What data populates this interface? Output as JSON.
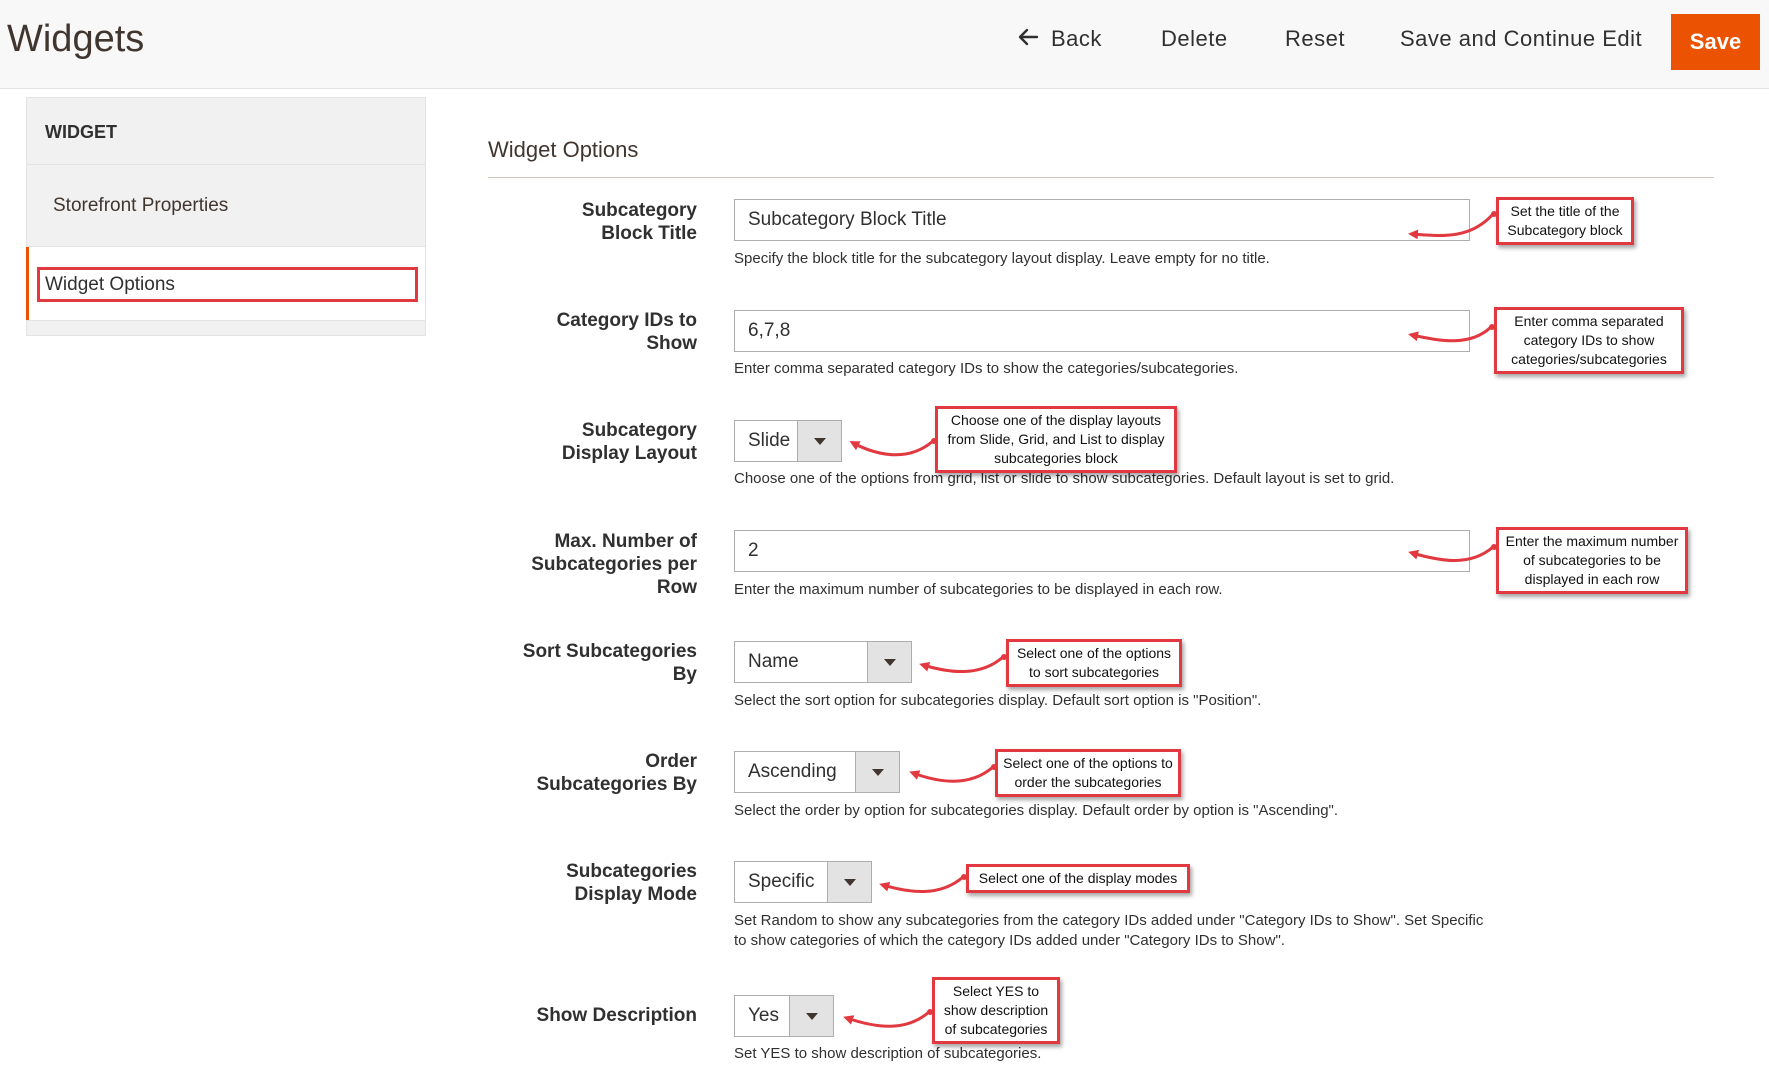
{
  "header": {
    "title": "Widgets",
    "back_label": "Back",
    "delete_label": "Delete",
    "reset_label": "Reset",
    "save_continue_label": "Save and Continue Edit",
    "save_label": "Save"
  },
  "sidebar": {
    "heading": "WIDGET",
    "items": [
      {
        "label": "Storefront Properties",
        "active": false
      },
      {
        "label": "Widget Options",
        "active": true
      }
    ]
  },
  "main": {
    "section_title": "Widget Options",
    "fields": [
      {
        "label": "Subcategory Block Title",
        "type": "text",
        "value": "Subcategory Block Title",
        "note": "Specify the block title for the subcategory layout display. Leave empty for no title.",
        "callout": "Set the title of the Subcategory block"
      },
      {
        "label": "Category IDs to Show",
        "type": "text",
        "value": "6,7,8",
        "note": "Enter comma separated category IDs to show the categories/subcategories.",
        "callout": "Enter comma separated category IDs to show categories/subcategories"
      },
      {
        "label": "Subcategory Display Layout",
        "type": "select",
        "value": "Slide",
        "note": "Choose one of the options from grid, list or slide to show subcategories. Default layout is set to grid.",
        "callout": "Choose one of the display layouts from Slide, Grid, and List to display subcategories block"
      },
      {
        "label": "Max. Number of Subcategories per Row",
        "type": "text",
        "value": "2",
        "note": "Enter the maximum number of subcategories to be displayed in each row.",
        "callout": "Enter the maximum number of subcategories to be displayed in each row"
      },
      {
        "label": "Sort Subcategories By",
        "type": "select",
        "value": "Name",
        "note": "Select the sort option for subcategories display. Default sort option is \"Position\".",
        "callout": "Select one of the options to sort subcategories"
      },
      {
        "label": "Order Subcategories By",
        "type": "select",
        "value": "Ascending",
        "note": "Select the order by option for subcategories display. Default order by option is \"Ascending\".",
        "callout": "Select one of the options to order the subcategories"
      },
      {
        "label": "Subcategories Display Mode",
        "type": "select",
        "value": "Specific",
        "note": "Set Random to show any subcategories from the category IDs added under \"Category IDs to Show\". Set Specific to show categories of which the category IDs added under \"Category IDs to Show\".",
        "callout": "Select one of the display modes"
      },
      {
        "label": "Show Description",
        "type": "select",
        "value": "Yes",
        "note": "Set YES to show description of subcategories.",
        "callout": "Select YES to show description of subcategories"
      }
    ]
  },
  "colors": {
    "accent": "#eb5202",
    "annotation": "#e2383f",
    "header_bg": "#f8f8f8"
  }
}
